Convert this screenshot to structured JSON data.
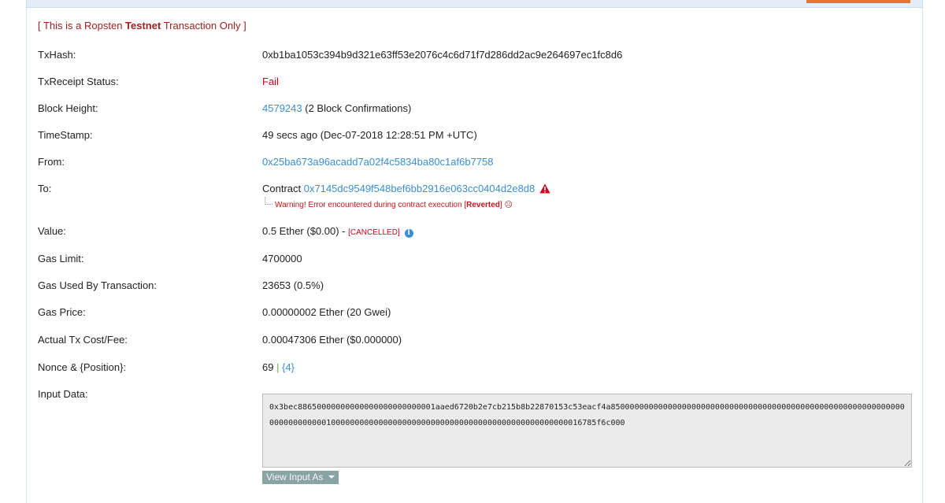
{
  "notice": {
    "prefix": "[ This is a Ropsten ",
    "bold": "Testnet",
    "suffix": " Transaction Only ]"
  },
  "rows": {
    "txhash": {
      "label": "TxHash:",
      "value": "0xb1ba1053c394b9d321e63ff53e2076c4c6d71f7d286dd2ac9e264697ec1fc8d6"
    },
    "status": {
      "label": "TxReceipt Status:",
      "value": "Fail"
    },
    "block": {
      "label": "Block Height:",
      "link": "4579243",
      "suffix": " (2 Block Confirmations)"
    },
    "timestamp": {
      "label": "TimeStamp:",
      "value": "49 secs ago (Dec-07-2018 12:28:51 PM +UTC)"
    },
    "from": {
      "label": "From:",
      "link": "0x25ba673a96acadd7a02f4c5834ba80c1af6b7758"
    },
    "to": {
      "label": "To:",
      "prefix": "Contract ",
      "link": "0x7145dc9549f548bef6bb2916e063cc0404d2e8d8",
      "warning_prefix": "Warning! Error encountered during contract execution [",
      "warning_bold": "Reverted",
      "warning_suffix": "] ☹"
    },
    "value": {
      "label": "Value:",
      "text": "0.5 Ether ($0.00) - ",
      "cancelled": "[CANCELLED]",
      "info_icon": "i"
    },
    "gas_limit": {
      "label": "Gas Limit:",
      "value": "4700000"
    },
    "gas_used": {
      "label": "Gas Used By Transaction:",
      "value": "23653 (0.5%)"
    },
    "gas_price": {
      "label": "Gas Price:",
      "value": "0.00000002 Ether (20 Gwei)"
    },
    "fee": {
      "label": "Actual Tx Cost/Fee:",
      "value": "0.00047306 Ether ($0.000000)"
    },
    "nonce": {
      "label": "Nonce & {Position}:",
      "nonce": "69",
      "sep": " | ",
      "position": "{4}"
    },
    "input": {
      "label": "Input Data:",
      "value": "0x3bec88650000000000000000000000001aaed6720b2e7cb215b8b22870153c53eacf4a85000000000000000000000000000000000000000000000000000000000000000000000000100000000000000000000000000000000000000000000000000016785f6c000",
      "button_label": "View Input As"
    }
  },
  "colors": {
    "link": "#3a8fd4",
    "error": "#d0021b",
    "notice": "#a11f1f",
    "accent_tab": "#e8742b"
  }
}
